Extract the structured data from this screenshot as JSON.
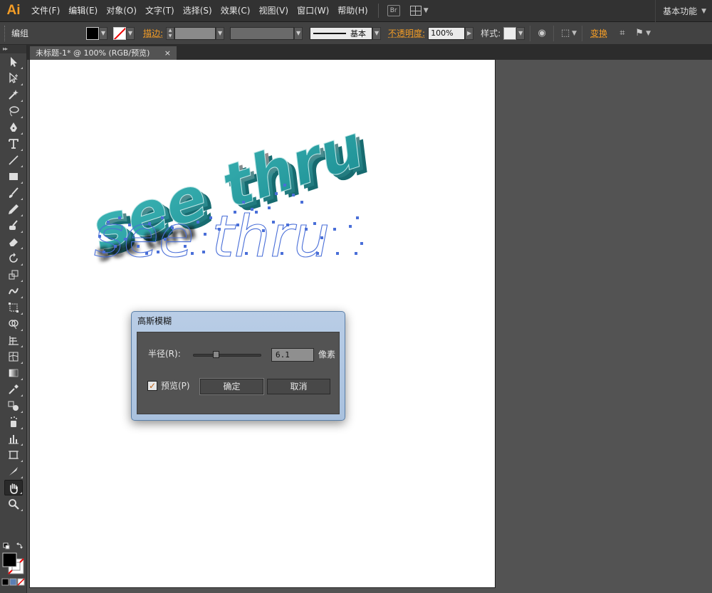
{
  "app": {
    "logo": "Ai",
    "workspace": "基本功能"
  },
  "menu": [
    "文件(F)",
    "编辑(E)",
    "对象(O)",
    "文字(T)",
    "选择(S)",
    "效果(C)",
    "视图(V)",
    "窗口(W)",
    "帮助(H)"
  ],
  "toolbar_br": "Br",
  "control": {
    "selection": "编组",
    "stroke_label": "描边:",
    "profile": "基本",
    "opacity_label": "不透明度:",
    "opacity_value": "100%",
    "style_label": "样式:",
    "transform_label": "变换"
  },
  "document": {
    "tab_title": "未标题-1* @ 100% (RGB/预览)",
    "close": "×"
  },
  "artwork": {
    "top_text": "see thru",
    "bottom_text": "see thru"
  },
  "dialog": {
    "title": "高斯模糊",
    "radius_label": "半径(R):",
    "radius_value": "6.1",
    "radius_unit": "像素",
    "radius_slider_fraction": 0.31,
    "preview_label": "预览(P)",
    "preview_checked": true,
    "ok_label": "确定",
    "cancel_label": "取消"
  },
  "colors": {
    "ai_orange": "#f49d26",
    "teal_3d": "#2aa3a6",
    "path_blue": "#4a6fd8"
  },
  "icons": [
    "selection-icon",
    "direct-selection-icon",
    "magic-wand-icon",
    "lasso-icon",
    "pen-icon",
    "type-icon",
    "line-icon",
    "rectangle-icon",
    "paintbrush-icon",
    "pencil-icon",
    "blob-brush-icon",
    "eraser-icon",
    "rotate-icon",
    "scale-icon",
    "warp-icon",
    "free-transform-icon",
    "shape-builder-icon",
    "perspective-grid-icon",
    "mesh-icon",
    "gradient-icon",
    "eyedropper-icon",
    "blend-icon",
    "symbol-sprayer-icon",
    "column-graph-icon",
    "artboard-icon",
    "slice-icon",
    "hand-icon",
    "zoom-icon"
  ]
}
